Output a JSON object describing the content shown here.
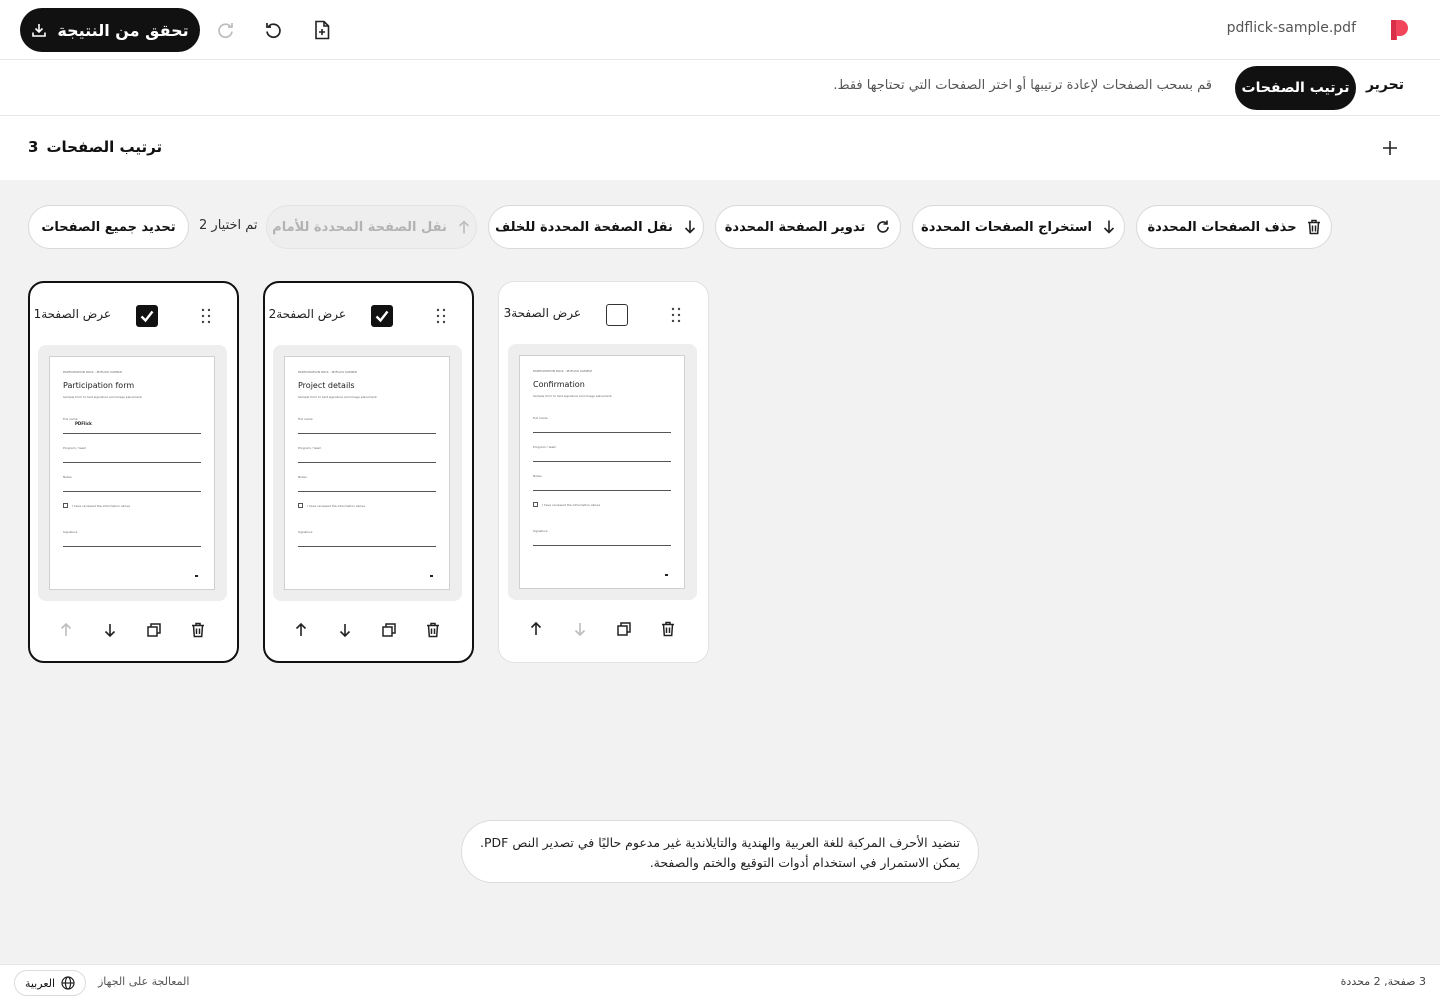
{
  "header": {
    "filename": "pdflick-sample.pdf",
    "result_button_label": "تحقق من النتيجة"
  },
  "modes": {
    "edit_label": "تحرير",
    "organize_label": "ترتيب الصفحات",
    "hint": "قم بسحب الصفحات لإعادة ترتيبها أو اختر الصفحات التي تحتاجها فقط."
  },
  "section": {
    "count": "3",
    "title": "ترتيب الصفحات"
  },
  "toolbar": {
    "delete_label": "حذف الصفحات المحددة",
    "extract_label": "استخراج الصفحات المحددة",
    "rotate_label": "تدوير الصفحة المحددة",
    "move_back_label": "نقل الصفحة المحددة للخلف",
    "move_forward_label": "نقل الصفحة المحددة للأمام",
    "selected_count": "تم اختيار 2",
    "select_all_label": "تحديد جميع الصفحات"
  },
  "pages": [
    {
      "label": "عرض الصفحة1",
      "checked": true,
      "thumb": {
        "header": "PARTICIPATION PACK - PDFLICK SAMPLE",
        "title": "Participation form",
        "subtitle": "Sample form to test signature and image placement",
        "fields": [
          "Full name",
          "Program / team",
          "Notes"
        ],
        "filled_value": "PDFlick",
        "checkbox_label": "I have reviewed the information above",
        "signature_label": "Signature"
      }
    },
    {
      "label": "عرض الصفحة2",
      "checked": true,
      "thumb": {
        "header": "PARTICIPATION PACK - PDFLICK SAMPLE",
        "title": "Project details",
        "subtitle": "Sample form to test signature and image placement",
        "fields": [
          "Full name",
          "Program / team",
          "Notes"
        ],
        "filled_value": "",
        "checkbox_label": "I have reviewed the information above",
        "signature_label": "Signature"
      }
    },
    {
      "label": "عرض الصفحة3",
      "checked": false,
      "thumb": {
        "header": "PARTICIPATION PACK - PDFLICK SAMPLE",
        "title": "Confirmation",
        "subtitle": "Sample form to test signature and image placement",
        "fields": [
          "Full name",
          "Program / team",
          "Notes"
        ],
        "filled_value": "",
        "checkbox_label": "I have reviewed the information above",
        "signature_label": "Signature"
      }
    }
  ],
  "notice": {
    "line1": "تنضيد الأحرف المركبة للغة العربية والهندية والتايلاندية غير مدعوم حاليًا في تصدير النص PDF.",
    "line2": "يمكن الاستمرار في استخدام أدوات التوقيع والختم والصفحة."
  },
  "footer": {
    "status": "3 صفحة, 2 محددة",
    "processing": "المعالجة على الجهاز",
    "language": "العربية"
  },
  "colors": {
    "accent": "#111111",
    "brand": "#f0455b",
    "background": "#f2f2f2"
  },
  "icons": [
    "brand-logo-icon",
    "download-icon",
    "redo-icon",
    "undo-icon",
    "add-file-icon",
    "plus-icon",
    "trash-icon",
    "arrow-down-icon",
    "rotate-icon",
    "arrow-up-icon",
    "check-icon",
    "drag-handle-icon",
    "duplicate-icon",
    "globe-icon"
  ]
}
